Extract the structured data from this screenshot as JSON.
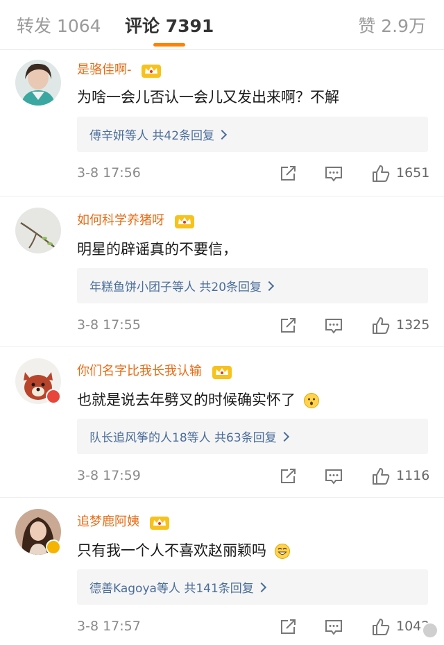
{
  "tabs": {
    "repost_label": "转发",
    "repost_count": "1064",
    "comments_label": "评论",
    "comments_count": "7391",
    "likes_label": "赞",
    "likes_count": "2.9万",
    "active_color": "#ff8200"
  },
  "comments": [
    {
      "username": "是骆佳啊-",
      "text": "为啥一会儿否认一会儿又发出来啊？不解",
      "reply_summary": "傅辛妍等人  共42条回复",
      "timestamp": "3-8 17:56",
      "like_count": "1651"
    },
    {
      "username": "如何科学养猪呀",
      "text": "明星的辟谣真的不要信，",
      "reply_summary": "年糕鱼饼小团子等人  共20条回复",
      "timestamp": "3-8 17:55",
      "like_count": "1325"
    },
    {
      "username": "你们名字比我长我认输",
      "text": "也就是说去年劈叉的时候确实怀了",
      "reply_summary": "队长追风筝的人18等人  共63条回复",
      "timestamp": "3-8 17:59",
      "like_count": "1116"
    },
    {
      "username": "追梦鹿阿姨",
      "text": "只有我一个人不喜欢赵丽颖吗",
      "reply_summary": "德善Kagoya等人  共141条回复",
      "timestamp": "3-8 17:57",
      "like_count": "1042"
    }
  ],
  "colors": {
    "username": "#e86b14",
    "reply_link": "#4a6d9a",
    "meta_gray": "#8a8a8a"
  },
  "icons": [
    "crown-badge-icon",
    "share-icon",
    "reply-icon",
    "like-icon",
    "chevron-right-icon",
    "surprised-emoji-icon",
    "grin-emoji-icon",
    "red-badge-icon",
    "gold-verified-icon"
  ]
}
